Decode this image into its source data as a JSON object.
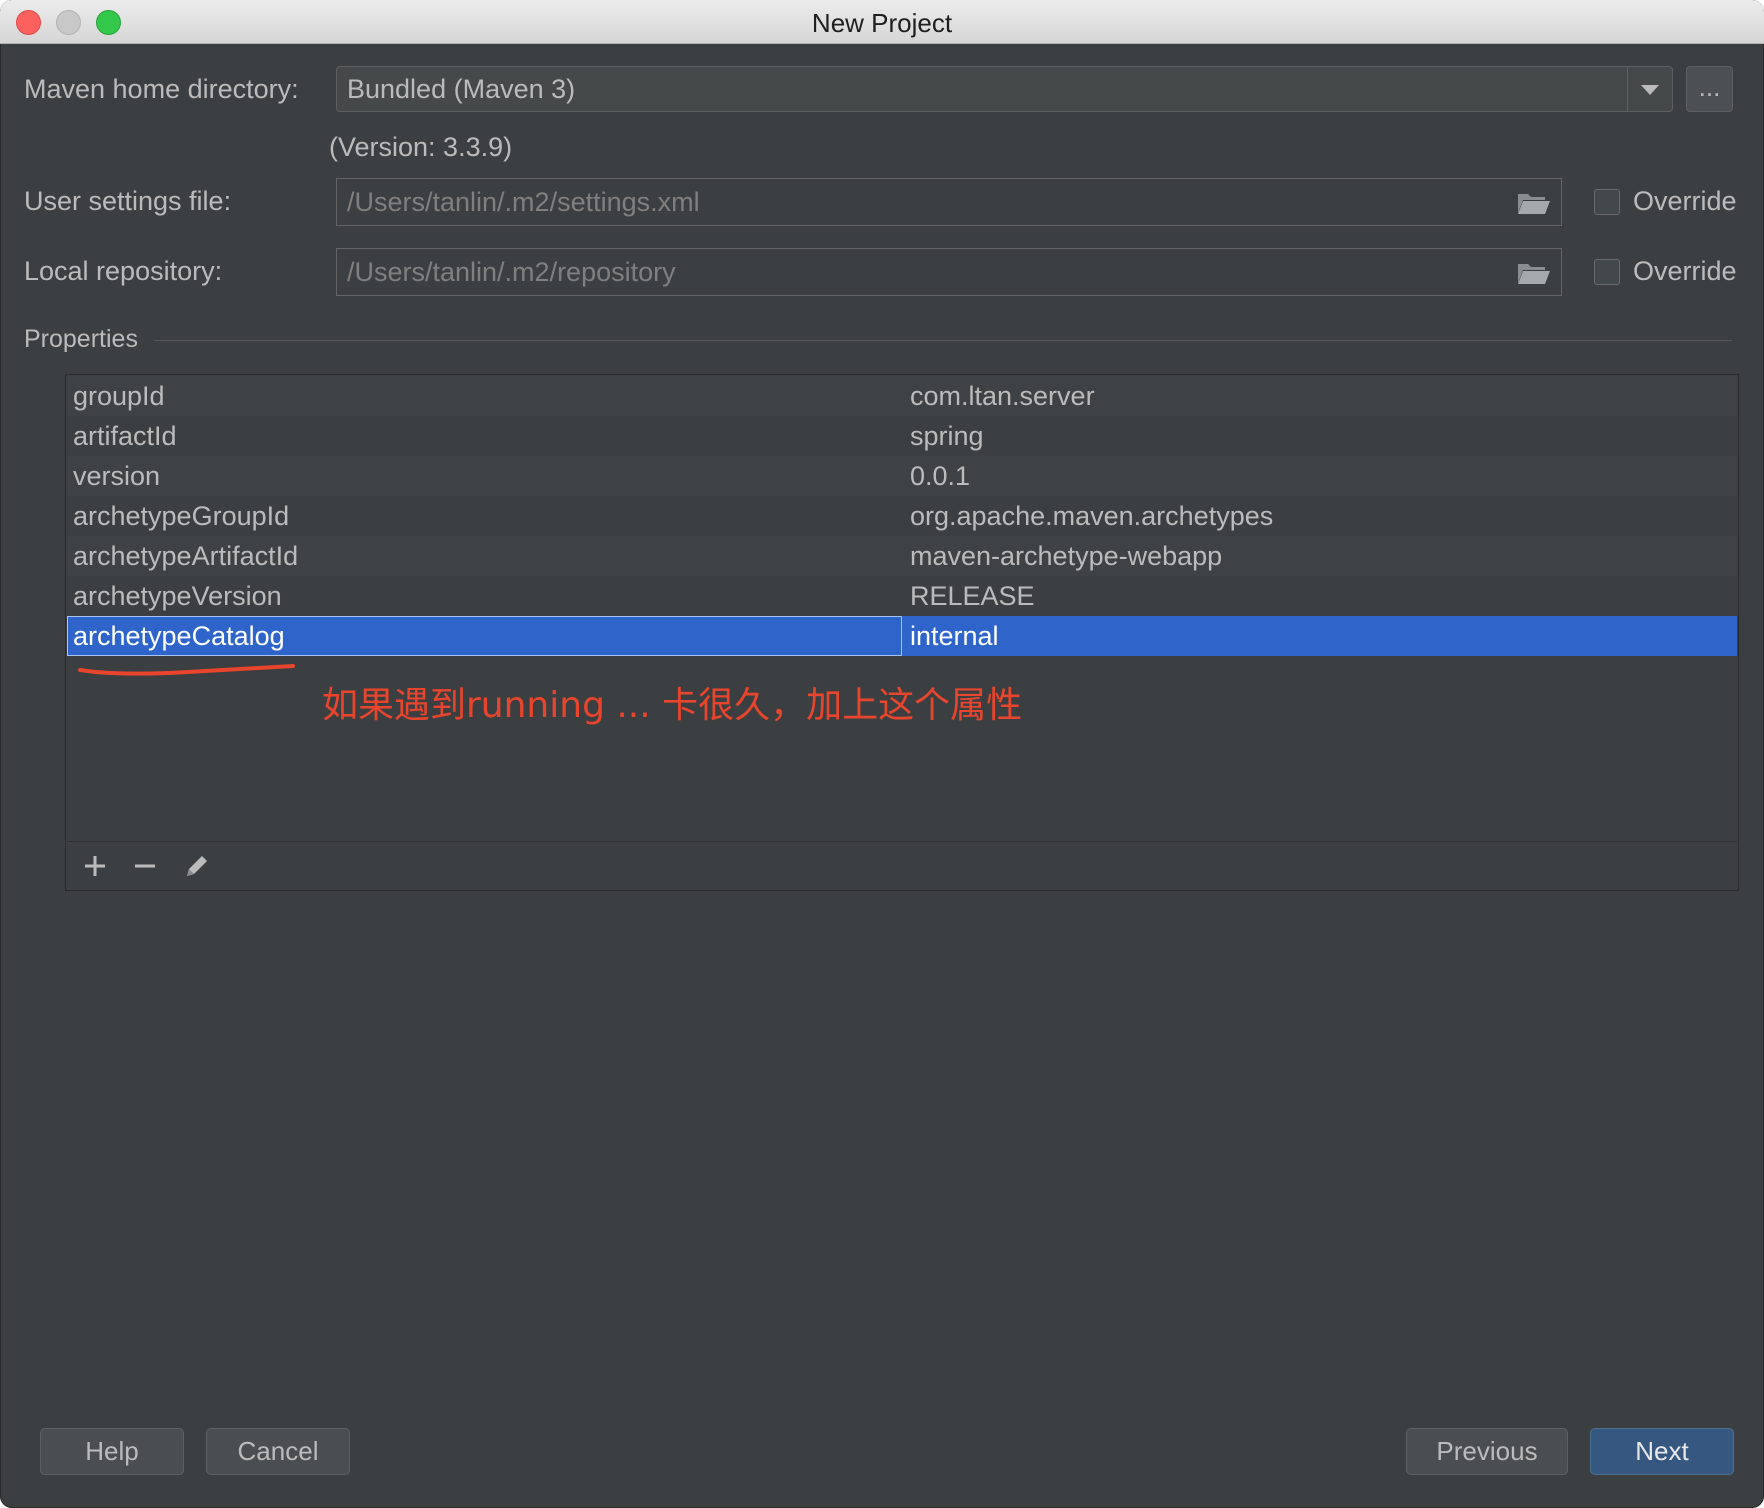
{
  "window": {
    "title": "New Project"
  },
  "maven_home": {
    "label": "Maven home directory:",
    "value": "Bundled (Maven 3)",
    "browse_label": "...",
    "version_note": "(Version: 3.3.9)"
  },
  "user_settings": {
    "label": "User settings file:",
    "value": "/Users/tanlin/.m2/settings.xml",
    "override_label": "Override",
    "override_checked": false
  },
  "local_repository": {
    "label": "Local repository:",
    "value": "/Users/tanlin/.m2/repository",
    "override_label": "Override",
    "override_checked": false
  },
  "properties": {
    "section_title": "Properties",
    "rows": [
      {
        "key": "groupId",
        "value": "com.ltan.server"
      },
      {
        "key": "artifactId",
        "value": "spring"
      },
      {
        "key": "version",
        "value": "0.0.1"
      },
      {
        "key": "archetypeGroupId",
        "value": "org.apache.maven.archetypes"
      },
      {
        "key": "archetypeArtifactId",
        "value": "maven-archetype-webapp"
      },
      {
        "key": "archetypeVersion",
        "value": "RELEASE"
      },
      {
        "key": "archetypeCatalog",
        "value": "internal"
      }
    ],
    "selected_row": "archetypeCatalog",
    "toolbar": {
      "icons": [
        "plus-icon",
        "minus-icon",
        "edit-pencil-icon"
      ]
    }
  },
  "annotation": {
    "text": "如果遇到running ... 卡很久，加上这个属性",
    "color": "#e8452c"
  },
  "buttons": {
    "help": "Help",
    "cancel": "Cancel",
    "previous": "Previous",
    "next": "Next"
  },
  "colors": {
    "background": "#3c3f41",
    "selection": "#2f65ca",
    "next_button": "#365880"
  }
}
